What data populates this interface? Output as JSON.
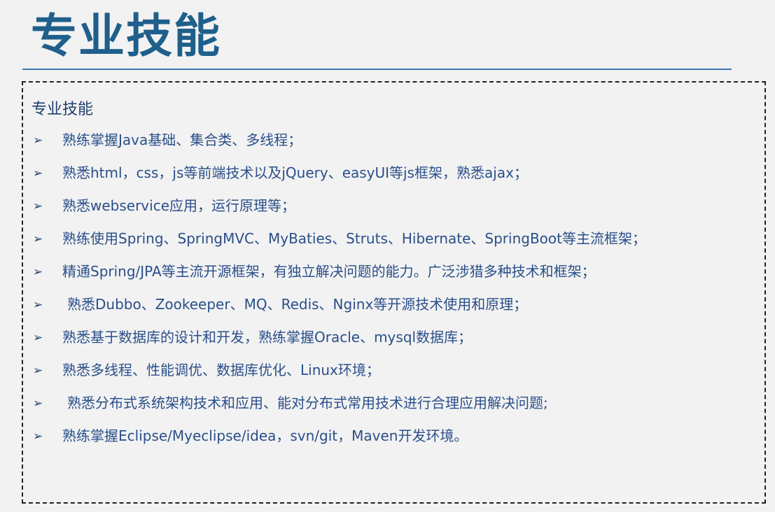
{
  "header": {
    "title": "专业技能"
  },
  "section": {
    "heading": "专业技能"
  },
  "bullet_glyph": "➢",
  "skills": [
    "熟练掌握Java基础、集合类、多线程；",
    "熟悉html，css，js等前端技术以及jQuery、easyUI等js框架，熟悉ajax；",
    "熟悉webservice应用，运行原理等；",
    "熟练使用Spring、SpringMVC、MyBaties、Struts、Hibernate、SpringBoot等主流框架；",
    "精通Spring/JPA等主流开源框架，有独立解决问题的能力。广泛涉猎多种技术和框架；",
    "熟悉Dubbo、Zookeeper、MQ、Redis、Nginx等开源技术使用和原理；",
    "熟悉基于数据库的设计和开发，熟练掌握Oracle、mysql数据库；",
    "熟悉多线程、性能调优、数据库优化、Linux环境；",
    "熟悉分布式系统架构技术和应用、能对分布式常用技术进行合理应用解决问题;",
    "熟练掌握Eclipse/Myeclipse/idea，svn/git，Maven开发环境。"
  ],
  "colors": {
    "title": "#1f5f8b",
    "rule": "#3a78b0",
    "text": "#2a4f8a",
    "background": "#f2f2f2"
  }
}
